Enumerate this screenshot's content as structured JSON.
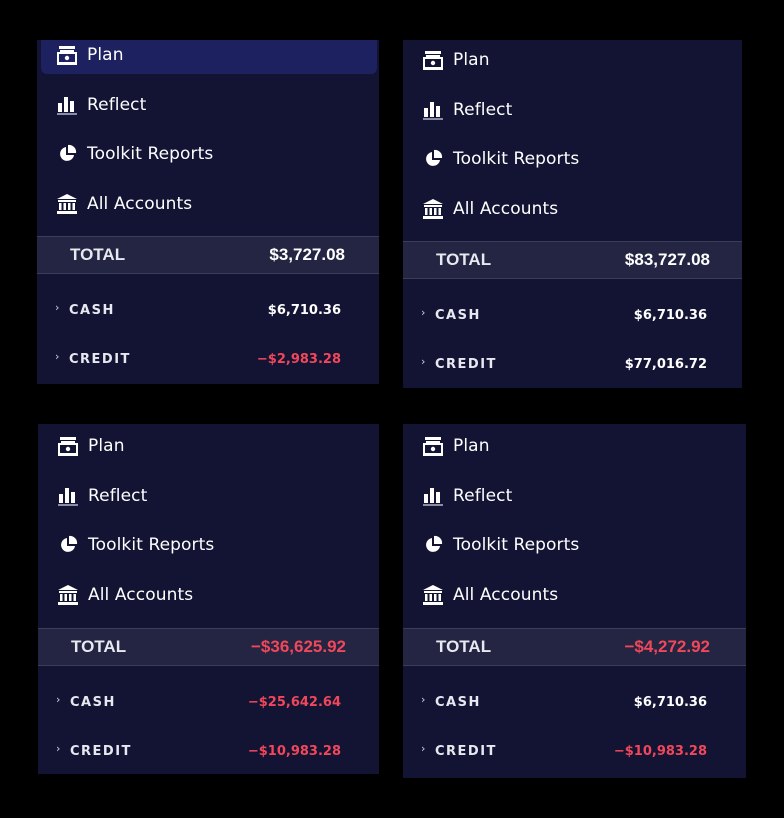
{
  "nav": {
    "plan_label": "Plan",
    "reflect_label": "Reflect",
    "toolkit_label": "Toolkit Reports",
    "accounts_label": "All Accounts"
  },
  "panels": [
    {
      "active": "plan",
      "total_label": "TOTAL",
      "total_value": "$3,727.08",
      "total_negative": false,
      "accounts": [
        {
          "name": "CASH",
          "value": "$6,710.36",
          "negative": false
        },
        {
          "name": "CREDIT",
          "value": "−$2,983.28",
          "negative": true
        }
      ]
    },
    {
      "active": "none",
      "total_label": "TOTAL",
      "total_value": "$83,727.08",
      "total_negative": false,
      "accounts": [
        {
          "name": "CASH",
          "value": "$6,710.36",
          "negative": false
        },
        {
          "name": "CREDIT",
          "value": "$77,016.72",
          "negative": false
        }
      ]
    },
    {
      "active": "none",
      "total_label": "TOTAL",
      "total_value": "−$36,625.92",
      "total_negative": true,
      "accounts": [
        {
          "name": "CASH",
          "value": "−$25,642.64",
          "negative": true
        },
        {
          "name": "CREDIT",
          "value": "−$10,983.28",
          "negative": true
        }
      ]
    },
    {
      "active": "none",
      "total_label": "TOTAL",
      "total_value": "−$4,272.92",
      "total_negative": true,
      "accounts": [
        {
          "name": "CASH",
          "value": "$6,710.36",
          "negative": false
        },
        {
          "name": "CREDIT",
          "value": "−$10,983.28",
          "negative": true
        }
      ]
    }
  ],
  "colors": {
    "background": "#000000",
    "panel": "#131434",
    "active_nav": "#1e2160",
    "total_row": "#232542",
    "negative": "#f0475a",
    "text": "#ffffff"
  },
  "icons": {
    "plan": "register-icon",
    "reflect": "bar-chart-icon",
    "toolkit": "pie-chart-icon",
    "accounts": "bank-icon"
  }
}
